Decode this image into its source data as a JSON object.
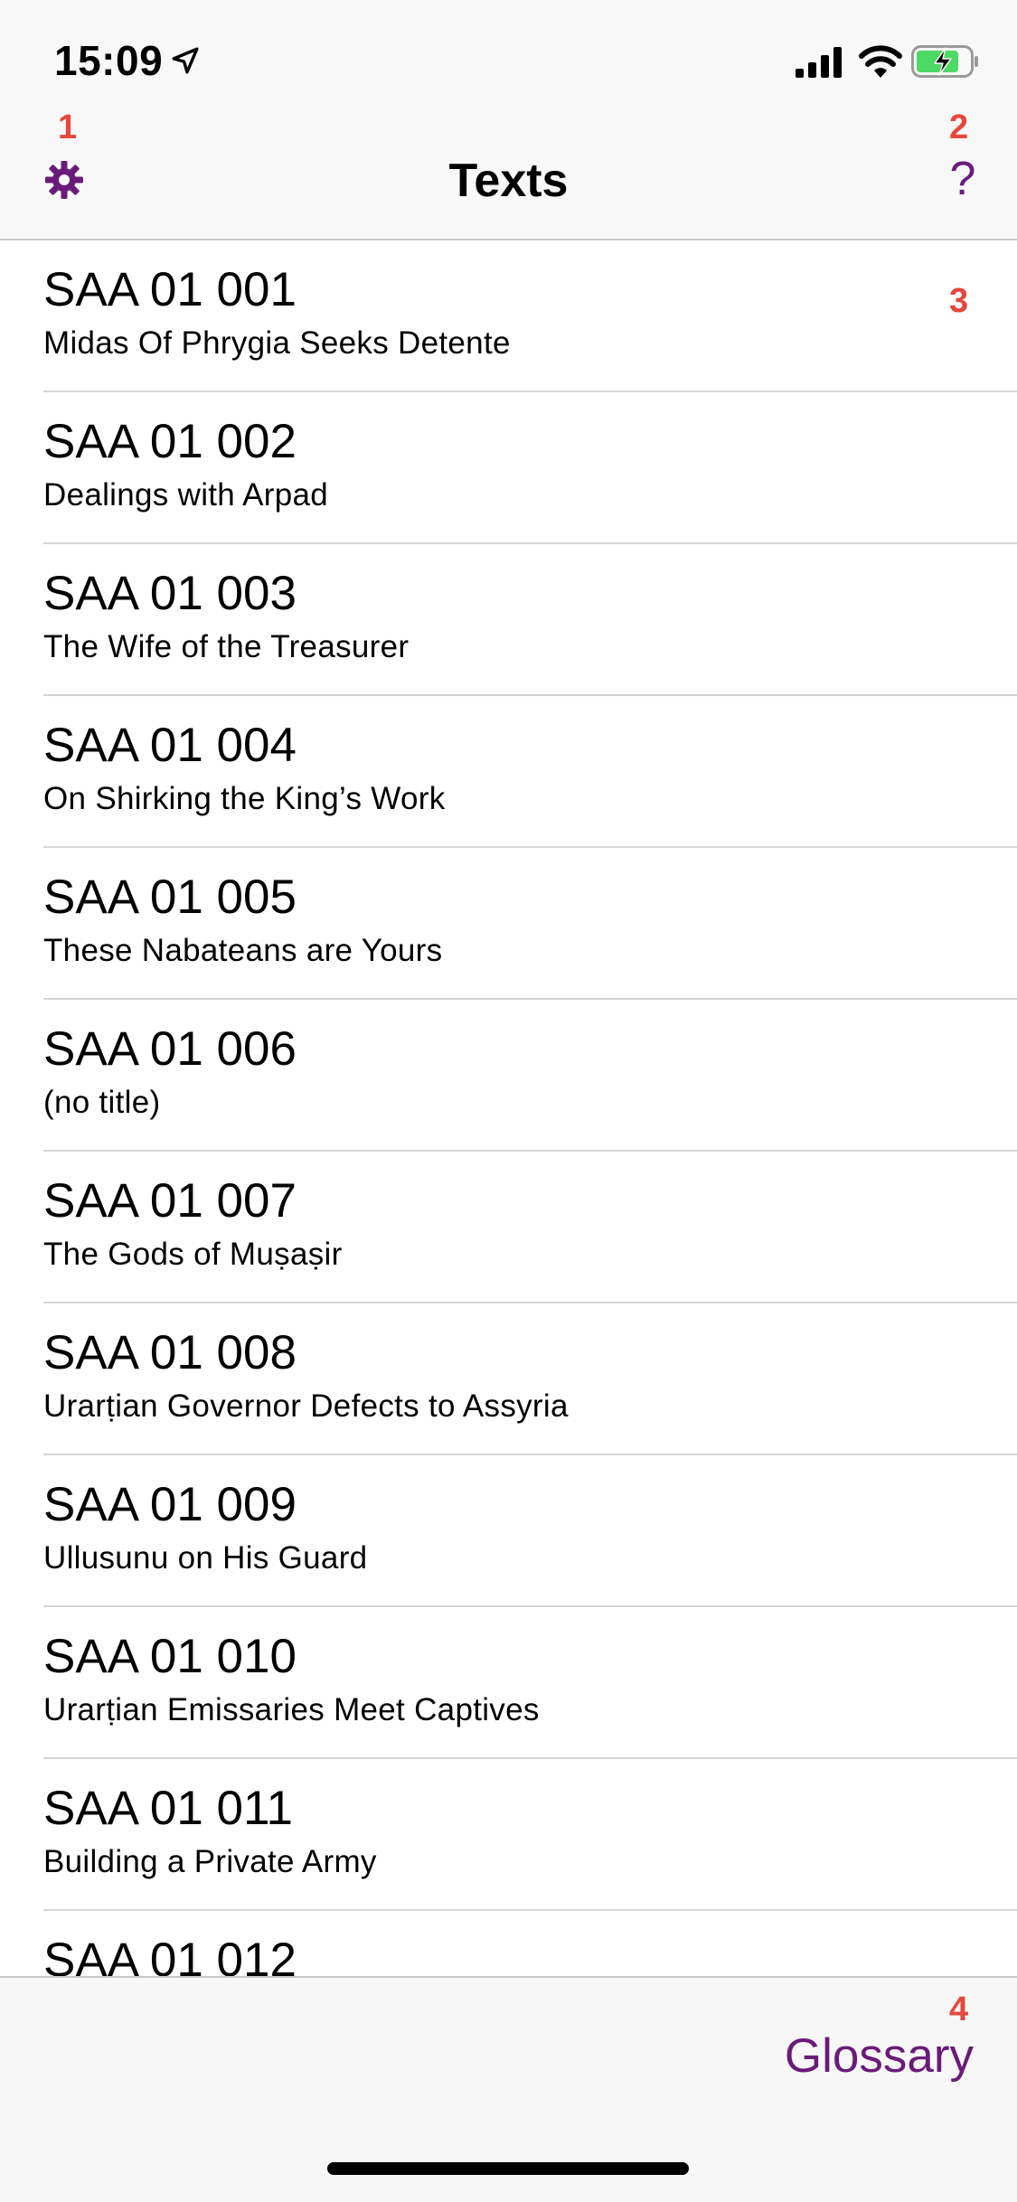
{
  "status_bar": {
    "time": "15:09",
    "icons": [
      "location-arrow-icon",
      "cellular-signal-icon",
      "wifi-icon",
      "battery-charging-icon"
    ]
  },
  "annotations": {
    "a1": "1",
    "a2": "2",
    "a3": "3",
    "a4": "4"
  },
  "nav": {
    "title": "Texts",
    "settings_icon": "gear-icon",
    "help_label": "?"
  },
  "list": {
    "items": [
      {
        "id": "SAA 01 001",
        "title": "Midas Of Phrygia Seeks Detente"
      },
      {
        "id": "SAA 01 002",
        "title": "Dealings with Arpad"
      },
      {
        "id": "SAA 01 003",
        "title": "The Wife of the Treasurer"
      },
      {
        "id": "SAA 01 004",
        "title": "On Shirking the King’s Work"
      },
      {
        "id": "SAA 01 005",
        "title": "These Nabateans are Yours"
      },
      {
        "id": "SAA 01 006",
        "title": "(no title)"
      },
      {
        "id": "SAA 01 007",
        "title": "The Gods of Muṣaṣir"
      },
      {
        "id": "SAA 01 008",
        "title": "Urarṭian Governor Defects to Assyria"
      },
      {
        "id": "SAA 01 009",
        "title": "Ullusunu on His Guard"
      },
      {
        "id": "SAA 01 010",
        "title": "Urarṭian Emissaries Meet Captives"
      },
      {
        "id": "SAA 01 011",
        "title": "Building a Private Army"
      },
      {
        "id": "SAA 01 012",
        "title": ""
      }
    ]
  },
  "toolbar": {
    "glossary_label": "Glossary"
  },
  "colors": {
    "accent": "#6a1b7a",
    "annotation": "#e5483b",
    "bar_background": "#f8f8f8",
    "separator": "#d6d6d9"
  }
}
